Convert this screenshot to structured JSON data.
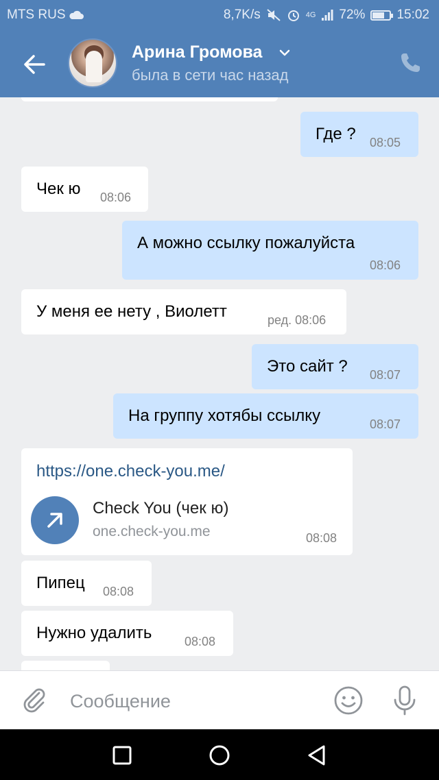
{
  "status_bar": {
    "carrier": "MTS RUS",
    "speed": "8,7K/s",
    "network": "4G",
    "battery": "72%",
    "battery_level": 0.72,
    "time": "15:02"
  },
  "header": {
    "name": "Арина Громова",
    "status": "была в сети час назад",
    "icons": [
      "back-arrow-icon",
      "chevron-down-icon",
      "phone-icon"
    ]
  },
  "messages": [
    {
      "dir": "out",
      "text": "Где ?",
      "time": "08:05"
    },
    {
      "dir": "in",
      "text": "Чек ю",
      "time": "08:06"
    },
    {
      "dir": "out",
      "text": "А можно ссылку пожалуйста",
      "time": "08:06"
    },
    {
      "dir": "in",
      "text": "У меня ее нету , Виолетт",
      "time": "ред. 08:06"
    },
    {
      "dir": "out",
      "text": "Это сайт ?",
      "time": "08:07"
    },
    {
      "dir": "out",
      "text": "На группу хотябы ссылку",
      "time": "08:07"
    },
    {
      "dir": "in",
      "type": "link",
      "url": "https://one.check-you.me/",
      "title": "Check You (чек ю)",
      "domain": "one.check-you.me",
      "time": "08:08"
    },
    {
      "dir": "in",
      "text": "Пипец",
      "time": "08:08"
    },
    {
      "dir": "in",
      "text": "Нужно удалить",
      "time": "08:08"
    }
  ],
  "composer": {
    "placeholder": "Сообщение",
    "icons": [
      "paperclip-icon",
      "emoji-icon",
      "microphone-icon"
    ]
  },
  "colors": {
    "header": "#5181b8",
    "incoming": "#ffffff",
    "outgoing": "#cce4ff",
    "background": "#edeef0",
    "link": "#2a5885"
  }
}
